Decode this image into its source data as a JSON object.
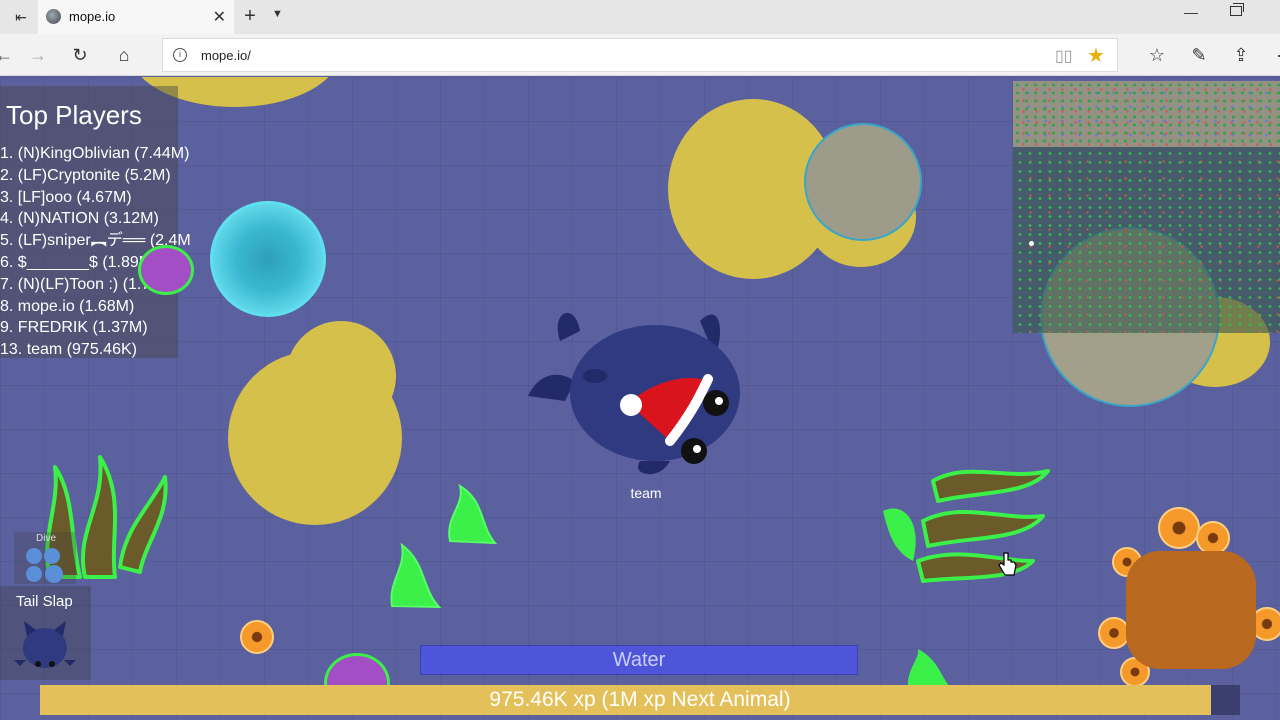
{
  "browser": {
    "tab_title": "mope.io",
    "url": "mope.io/"
  },
  "leaderboard": {
    "title": "Top Players",
    "entries": [
      "1. (N)KingOblivian (7.44M)",
      "2. (LF)Cryptonite (5.2M)",
      "3. [LF]ooo (4.67M)",
      "4. (N)NATION (3.12M)",
      "5. (LF)sniper︻デ══ (2.4M",
      "6. $_______$ (1.89M)",
      "7. (N)(LF)Toon :) (1.72M)",
      "8. mope.io (1.68M)",
      "9. FREDRIK (1.37M)",
      "13. team (975.46K)"
    ]
  },
  "player": {
    "name": "team"
  },
  "abilities": {
    "dive_label": "Dive",
    "tail_slap_label": "Tail Slap"
  },
  "water": {
    "label": "Water",
    "level": 1.0
  },
  "xp": {
    "label": "975.46K xp  (1M xp Next Animal)",
    "current": 975460,
    "next": 1000000
  },
  "colors": {
    "ocean": "#5b609f",
    "food_yellow": "#d6c04c",
    "kelp_green": "#3cf04a",
    "xp_bar": "#e4c05a",
    "water_bar": "#4f55d9",
    "player_body": "#2f3a80"
  }
}
